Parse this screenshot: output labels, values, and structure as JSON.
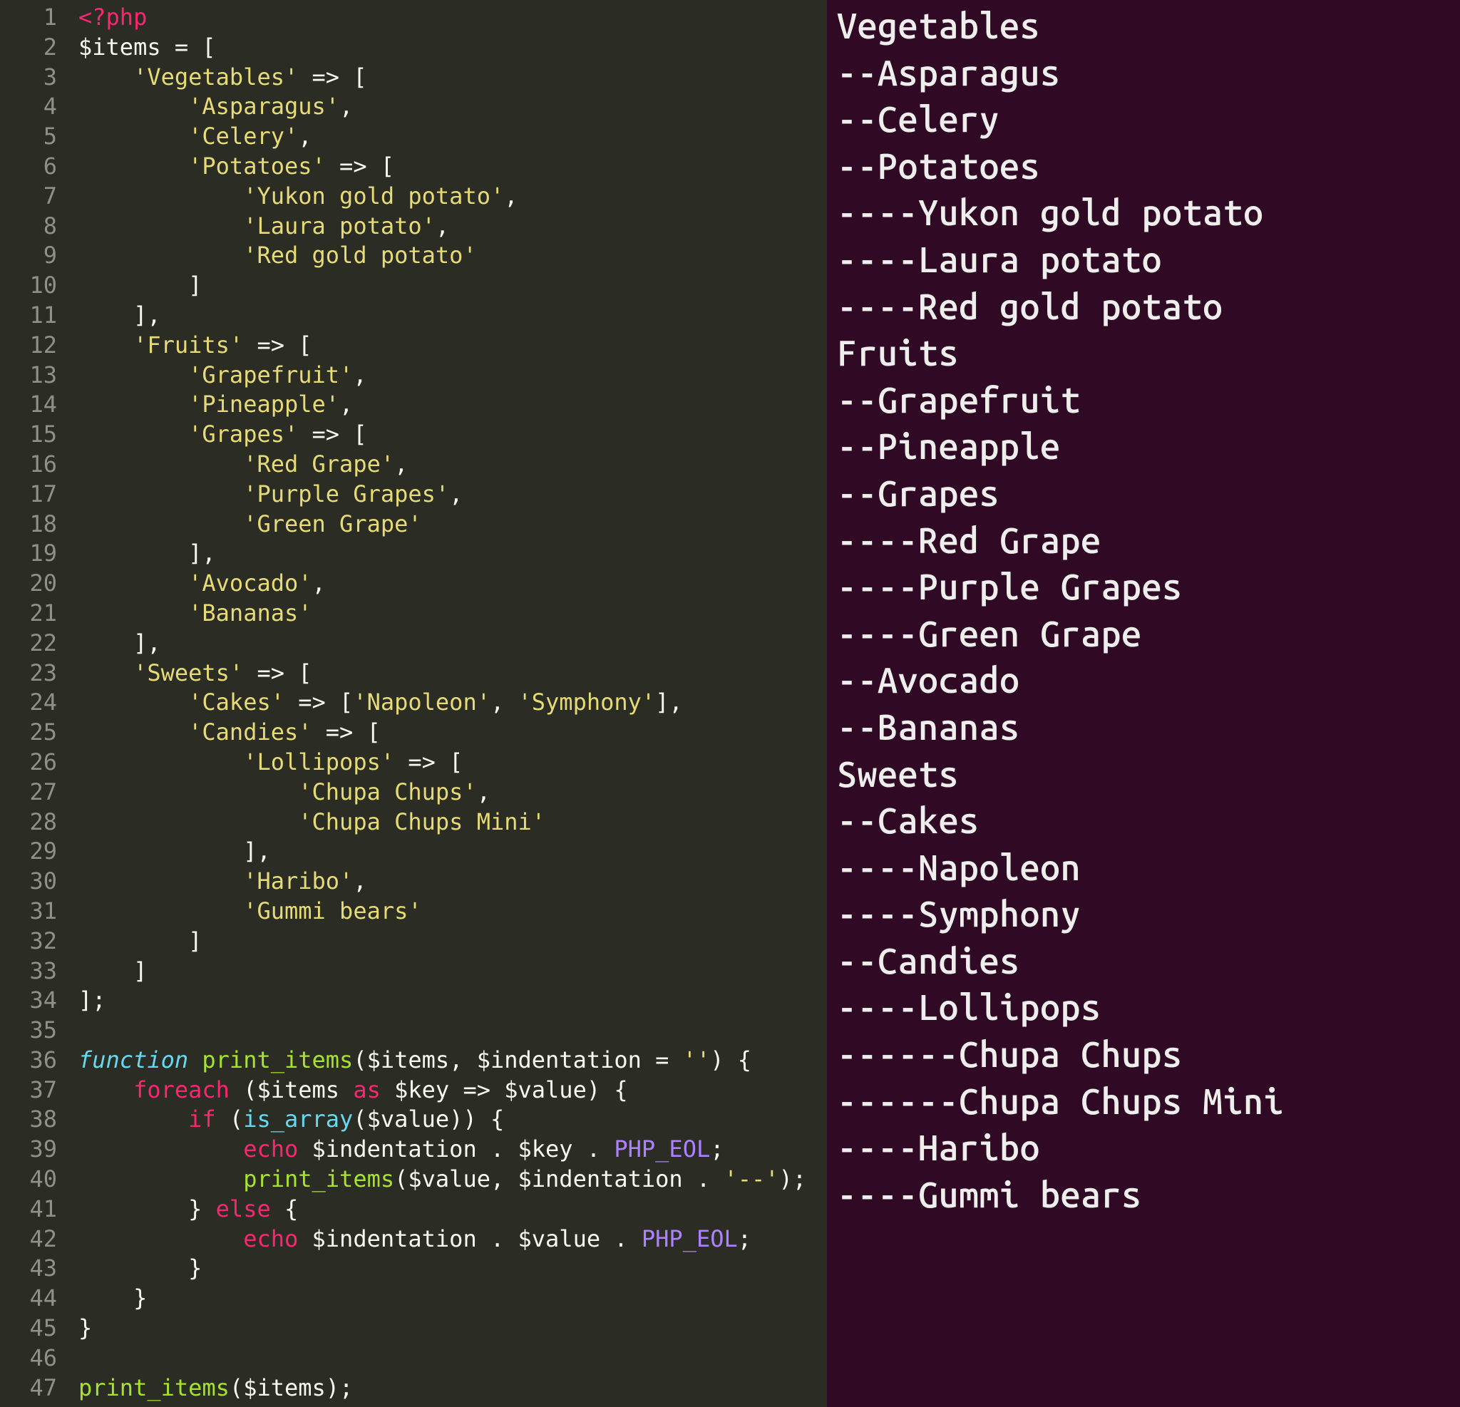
{
  "editor": {
    "line_count": 47,
    "lines": [
      [
        [
          "tag",
          "<?php"
        ]
      ],
      [
        [
          "var",
          "$items"
        ],
        [
          "op",
          " = ["
        ]
      ],
      [
        [
          "op",
          "    "
        ],
        [
          "str",
          "'Vegetables'"
        ],
        [
          "op",
          " => ["
        ]
      ],
      [
        [
          "op",
          "        "
        ],
        [
          "str",
          "'Asparagus'"
        ],
        [
          "op",
          ","
        ]
      ],
      [
        [
          "op",
          "        "
        ],
        [
          "str",
          "'Celery'"
        ],
        [
          "op",
          ","
        ]
      ],
      [
        [
          "op",
          "        "
        ],
        [
          "str",
          "'Potatoes'"
        ],
        [
          "op",
          " => ["
        ]
      ],
      [
        [
          "op",
          "            "
        ],
        [
          "str",
          "'Yukon gold potato'"
        ],
        [
          "op",
          ","
        ]
      ],
      [
        [
          "op",
          "            "
        ],
        [
          "str",
          "'Laura potato'"
        ],
        [
          "op",
          ","
        ]
      ],
      [
        [
          "op",
          "            "
        ],
        [
          "str",
          "'Red gold potato'"
        ]
      ],
      [
        [
          "op",
          "        ]"
        ]
      ],
      [
        [
          "op",
          "    ],"
        ]
      ],
      [
        [
          "op",
          "    "
        ],
        [
          "str",
          "'Fruits'"
        ],
        [
          "op",
          " => ["
        ]
      ],
      [
        [
          "op",
          "        "
        ],
        [
          "str",
          "'Grapefruit'"
        ],
        [
          "op",
          ","
        ]
      ],
      [
        [
          "op",
          "        "
        ],
        [
          "str",
          "'Pineapple'"
        ],
        [
          "op",
          ","
        ]
      ],
      [
        [
          "op",
          "        "
        ],
        [
          "str",
          "'Grapes'"
        ],
        [
          "op",
          " => ["
        ]
      ],
      [
        [
          "op",
          "            "
        ],
        [
          "str",
          "'Red Grape'"
        ],
        [
          "op",
          ","
        ]
      ],
      [
        [
          "op",
          "            "
        ],
        [
          "str",
          "'Purple Grapes'"
        ],
        [
          "op",
          ","
        ]
      ],
      [
        [
          "op",
          "            "
        ],
        [
          "str",
          "'Green Grape'"
        ]
      ],
      [
        [
          "op",
          "        ],"
        ]
      ],
      [
        [
          "op",
          "        "
        ],
        [
          "str",
          "'Avocado'"
        ],
        [
          "op",
          ","
        ]
      ],
      [
        [
          "op",
          "        "
        ],
        [
          "str",
          "'Bananas'"
        ]
      ],
      [
        [
          "op",
          "    ],"
        ]
      ],
      [
        [
          "op",
          "    "
        ],
        [
          "str",
          "'Sweets'"
        ],
        [
          "op",
          " => ["
        ]
      ],
      [
        [
          "op",
          "        "
        ],
        [
          "str",
          "'Cakes'"
        ],
        [
          "op",
          " => ["
        ],
        [
          "str",
          "'Napoleon'"
        ],
        [
          "op",
          ", "
        ],
        [
          "str",
          "'Symphony'"
        ],
        [
          "op",
          "],"
        ]
      ],
      [
        [
          "op",
          "        "
        ],
        [
          "str",
          "'Candies'"
        ],
        [
          "op",
          " => ["
        ]
      ],
      [
        [
          "op",
          "            "
        ],
        [
          "str",
          "'Lollipops'"
        ],
        [
          "op",
          " => ["
        ]
      ],
      [
        [
          "op",
          "                "
        ],
        [
          "str",
          "'Chupa Chups'"
        ],
        [
          "op",
          ","
        ]
      ],
      [
        [
          "op",
          "                "
        ],
        [
          "str",
          "'Chupa Chups Mini'"
        ]
      ],
      [
        [
          "op",
          "            ],"
        ]
      ],
      [
        [
          "op",
          "            "
        ],
        [
          "str",
          "'Haribo'"
        ],
        [
          "op",
          ","
        ]
      ],
      [
        [
          "op",
          "            "
        ],
        [
          "str",
          "'Gummi bears'"
        ]
      ],
      [
        [
          "op",
          "        ]"
        ]
      ],
      [
        [
          "op",
          "    ]"
        ]
      ],
      [
        [
          "op",
          "];"
        ]
      ],
      [
        [
          "op",
          ""
        ]
      ],
      [
        [
          "kw",
          "function"
        ],
        [
          "op",
          " "
        ],
        [
          "fn",
          "print_items"
        ],
        [
          "op",
          "("
        ],
        [
          "var",
          "$items"
        ],
        [
          "op",
          ", "
        ],
        [
          "var",
          "$indentation"
        ],
        [
          "op",
          " = "
        ],
        [
          "str",
          "''"
        ],
        [
          "op",
          ") {"
        ]
      ],
      [
        [
          "op",
          "    "
        ],
        [
          "kw2",
          "foreach"
        ],
        [
          "op",
          " ("
        ],
        [
          "var",
          "$items"
        ],
        [
          "op",
          " "
        ],
        [
          "kw2",
          "as"
        ],
        [
          "op",
          " "
        ],
        [
          "var",
          "$key"
        ],
        [
          "op",
          " => "
        ],
        [
          "var",
          "$value"
        ],
        [
          "op",
          ") {"
        ]
      ],
      [
        [
          "op",
          "        "
        ],
        [
          "kw2",
          "if"
        ],
        [
          "op",
          " ("
        ],
        [
          "builtin",
          "is_array"
        ],
        [
          "op",
          "("
        ],
        [
          "var",
          "$value"
        ],
        [
          "op",
          ")) {"
        ]
      ],
      [
        [
          "op",
          "            "
        ],
        [
          "kw2",
          "echo"
        ],
        [
          "op",
          " "
        ],
        [
          "var",
          "$indentation"
        ],
        [
          "op",
          " . "
        ],
        [
          "var",
          "$key"
        ],
        [
          "op",
          " . "
        ],
        [
          "const",
          "PHP_EOL"
        ],
        [
          "op",
          ";"
        ]
      ],
      [
        [
          "op",
          "            "
        ],
        [
          "fn",
          "print_items"
        ],
        [
          "op",
          "("
        ],
        [
          "var",
          "$value"
        ],
        [
          "op",
          ", "
        ],
        [
          "var",
          "$indentation"
        ],
        [
          "op",
          " . "
        ],
        [
          "str",
          "'--'"
        ],
        [
          "op",
          ");"
        ]
      ],
      [
        [
          "op",
          "        } "
        ],
        [
          "kw2",
          "else"
        ],
        [
          "op",
          " {"
        ]
      ],
      [
        [
          "op",
          "            "
        ],
        [
          "kw2",
          "echo"
        ],
        [
          "op",
          " "
        ],
        [
          "var",
          "$indentation"
        ],
        [
          "op",
          " . "
        ],
        [
          "var",
          "$value"
        ],
        [
          "op",
          " . "
        ],
        [
          "const",
          "PHP_EOL"
        ],
        [
          "op",
          ";"
        ]
      ],
      [
        [
          "op",
          "        }"
        ]
      ],
      [
        [
          "op",
          "    }"
        ]
      ],
      [
        [
          "op",
          "}"
        ]
      ],
      [
        [
          "op",
          ""
        ]
      ],
      [
        [
          "fn",
          "print_items"
        ],
        [
          "op",
          "("
        ],
        [
          "var",
          "$items"
        ],
        [
          "op",
          ");"
        ]
      ]
    ]
  },
  "terminal": {
    "lines": [
      "Vegetables",
      "--Asparagus",
      "--Celery",
      "--Potatoes",
      "----Yukon gold potato",
      "----Laura potato",
      "----Red gold potato",
      "Fruits",
      "--Grapefruit",
      "--Pineapple",
      "--Grapes",
      "----Red Grape",
      "----Purple Grapes",
      "----Green Grape",
      "--Avocado",
      "--Bananas",
      "Sweets",
      "--Cakes",
      "----Napoleon",
      "----Symphony",
      "--Candies",
      "----Lollipops",
      "------Chupa Chups",
      "------Chupa Chups Mini",
      "----Haribo",
      "----Gummi bears"
    ]
  }
}
